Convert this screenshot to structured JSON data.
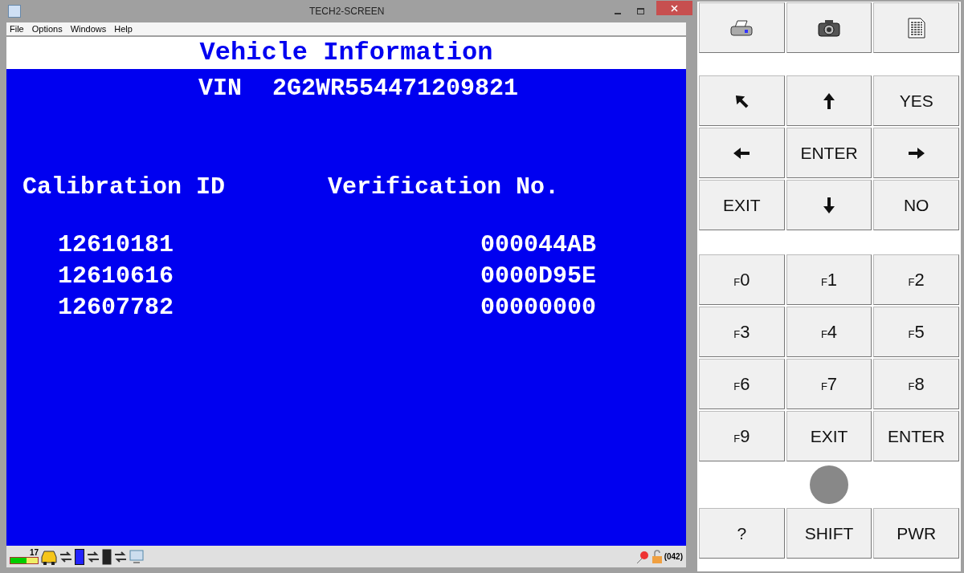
{
  "window": {
    "title": "TECH2-SCREEN"
  },
  "menu": [
    "File",
    "Options",
    "Windows",
    "Help"
  ],
  "screen": {
    "header": "Vehicle Information",
    "vin_label": "VIN",
    "vin": "2G2WR554471209821",
    "columns": [
      "Calibration ID",
      "Verification No."
    ],
    "rows": [
      [
        "12610181",
        "000044AB"
      ],
      [
        "12610616",
        "0000D95E"
      ],
      [
        "12607782",
        "00000000"
      ]
    ]
  },
  "status_bar": {
    "signal": "17",
    "counter": "(042)"
  },
  "keypad": [
    [
      [
        {
          "kind": "printer"
        },
        {
          "kind": "camera"
        },
        {
          "kind": "document"
        }
      ]
    ],
    [
      [
        {
          "kind": "upleft"
        },
        {
          "kind": "up"
        },
        {
          "kind": "text",
          "label": "YES"
        }
      ],
      [
        {
          "kind": "left"
        },
        {
          "kind": "text",
          "label": "ENTER"
        },
        {
          "kind": "right"
        }
      ],
      [
        {
          "kind": "text",
          "label": "EXIT"
        },
        {
          "kind": "down"
        },
        {
          "kind": "text",
          "label": "NO"
        }
      ]
    ],
    [
      [
        {
          "kind": "function",
          "prefix": "F",
          "label": "0"
        },
        {
          "kind": "function",
          "prefix": "F",
          "label": "1"
        },
        {
          "kind": "function",
          "prefix": "F",
          "label": "2"
        }
      ],
      [
        {
          "kind": "function",
          "prefix": "F",
          "label": "3"
        },
        {
          "kind": "function",
          "prefix": "F",
          "label": "4"
        },
        {
          "kind": "function",
          "prefix": "F",
          "label": "5"
        }
      ],
      [
        {
          "kind": "function",
          "prefix": "F",
          "label": "6"
        },
        {
          "kind": "function",
          "prefix": "F",
          "label": "7"
        },
        {
          "kind": "function",
          "prefix": "F",
          "label": "8"
        }
      ],
      [
        {
          "kind": "function",
          "prefix": "F",
          "label": "9"
        },
        {
          "kind": "text",
          "label": "EXIT"
        },
        {
          "kind": "text",
          "label": "ENTER"
        }
      ]
    ],
    [
      [
        {
          "kind": "text",
          "label": "?"
        },
        {
          "kind": "text",
          "label": "SHIFT"
        },
        {
          "kind": "text",
          "label": "PWR"
        }
      ]
    ]
  ]
}
